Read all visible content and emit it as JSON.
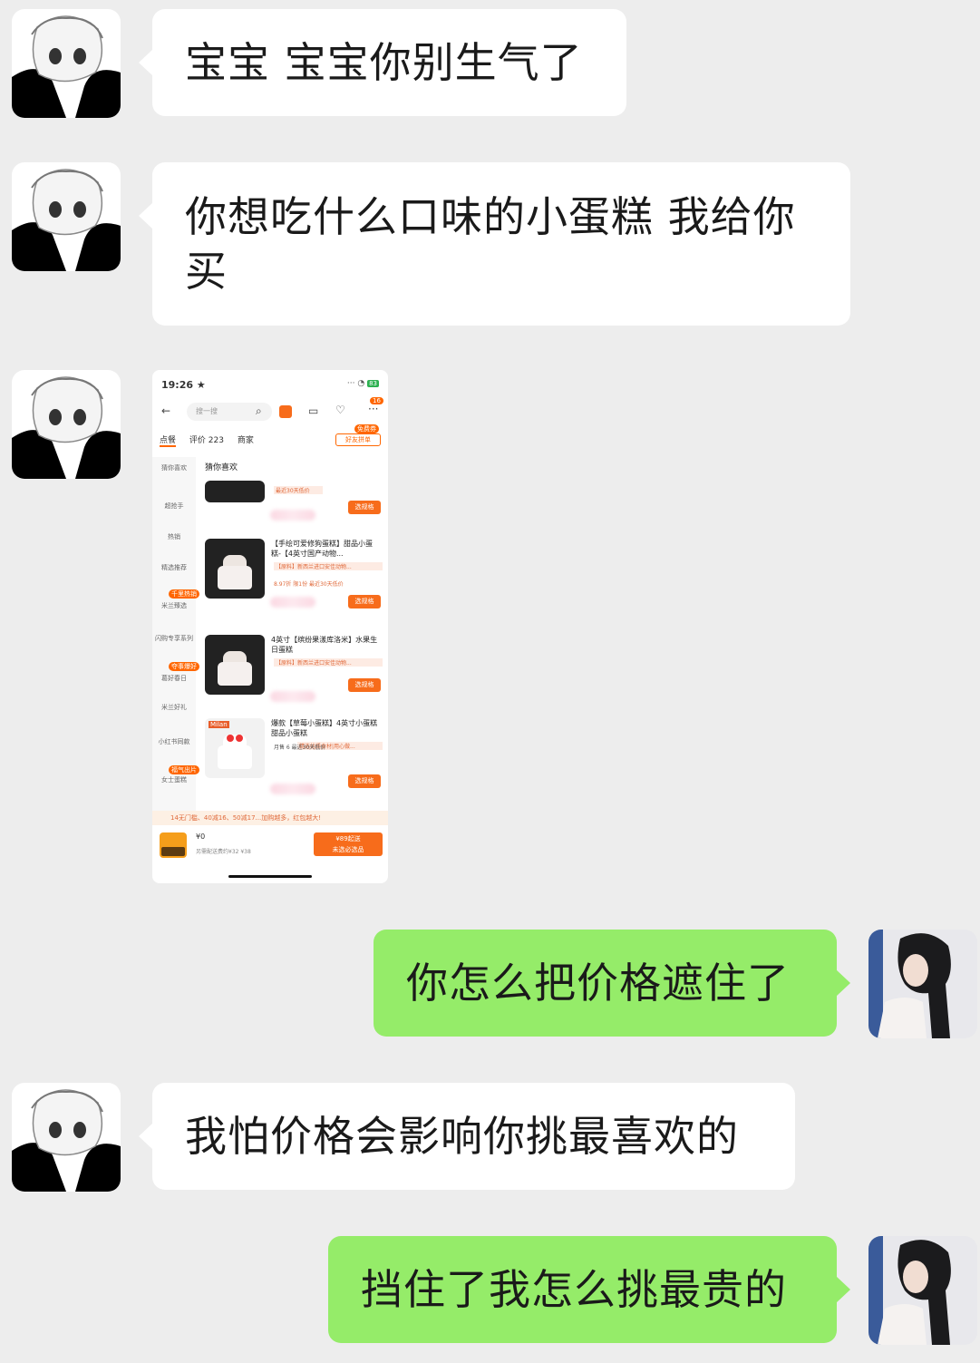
{
  "messages": [
    {
      "side": "in",
      "text": "宝宝 宝宝你别生气了"
    },
    {
      "side": "in",
      "text": "你想吃什么口味的小蛋糕 我给你买"
    },
    {
      "side": "out",
      "text": "你怎么把价格遮住了"
    },
    {
      "side": "in",
      "text": "我怕价格会影响你挑最喜欢的"
    },
    {
      "side": "out",
      "text": "挡住了我怎么挑最贵的"
    }
  ],
  "screenshot": {
    "status_time": "19:26 ★",
    "status_right": "···",
    "battery": "83",
    "search_placeholder": "搜一搜",
    "badge_count": "16",
    "tabs": [
      "点餐",
      "评价 223",
      "商家"
    ],
    "friend_tag": "好友拼单",
    "friend_badge": "免费券",
    "section_title": "猜你喜欢",
    "sidebar": [
      "猜你喜欢",
      "超抢手",
      "热销",
      "精选推荐",
      "米兰臻选",
      "闪购专享系列",
      "葛好春日",
      "米兰好礼",
      "小红书同款",
      "女士蛋糕"
    ],
    "sidebar_badges": [
      "千里热销",
      "夺事爆好",
      "福气出片"
    ],
    "products": [
      {
        "title": "",
        "sub": "最近30天低价",
        "meta": ""
      },
      {
        "title": "【手绘可爱修狗蛋糕】甜品小蛋糕-【4英寸国产动物...",
        "sub": "【原料】新西兰进口安佳动物...",
        "meta": "8.97折  限1份  最近30天低价"
      },
      {
        "title": "4英寸【缤纷果漾库洛米】水果生日蛋糕",
        "sub": "【原料】新西兰进口安佳动物...",
        "meta": ""
      },
      {
        "title": "爆款【草莓小蛋糕】4英寸小蛋糕甜品小蛋糕",
        "sub": "精选优质食材|用心做...",
        "meta": "月售 6    最近30天低价"
      }
    ],
    "select_label": "选规格",
    "product_brand": "Milan",
    "promo": "14无门槛、40减16、50减17...加购越多，红包越大!",
    "cart_price": "¥0",
    "cart_sub": "另需配送费约¥32  ¥38",
    "go_line1": "¥89起送",
    "go_line2": "未选必选品"
  }
}
